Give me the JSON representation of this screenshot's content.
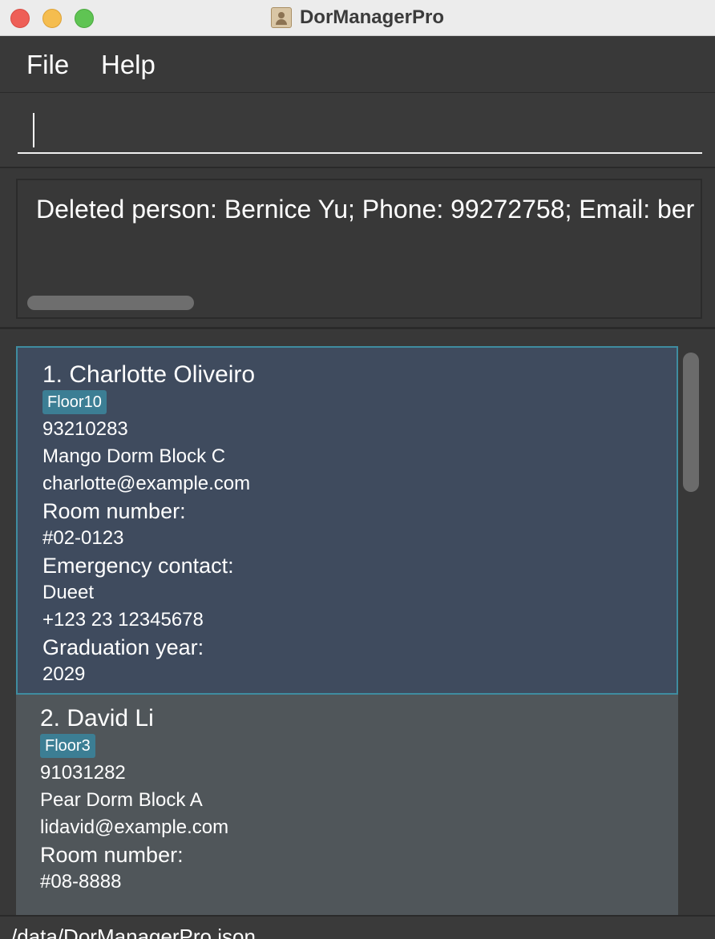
{
  "window": {
    "title": "DorManagerPro"
  },
  "menu": {
    "items": [
      "File",
      "Help"
    ]
  },
  "command": {
    "value": "",
    "placeholder": ""
  },
  "result": {
    "text": "Deleted person: Bernice Yu; Phone: 99272758; Email: ber"
  },
  "persons": [
    {
      "index_name": "1. Charlotte Oliveiro",
      "tag": "Floor10",
      "phone": "93210283",
      "address": "Mango Dorm Block C",
      "email": "charlotte@example.com",
      "room_label": "Room number:",
      "room": "#02-0123",
      "emergency_label": "Emergency contact:",
      "emergency_name": "Dueet",
      "emergency_phone": "+123 23 12345678",
      "graduation_label": "Graduation year:",
      "graduation_year": "2029"
    },
    {
      "index_name": "2. David Li",
      "tag": "Floor3",
      "phone": "91031282",
      "address": "Pear Dorm Block A",
      "email": "lidavid@example.com",
      "room_label": "Room number:",
      "room": "#08-8888"
    }
  ],
  "status": {
    "path": "/data/DorManagerPro.json"
  },
  "colors": {
    "selected_card": "#3f4b5e",
    "card": "#50565a",
    "tag": "#3c7e94",
    "selected_border": "#3f8ca0"
  }
}
